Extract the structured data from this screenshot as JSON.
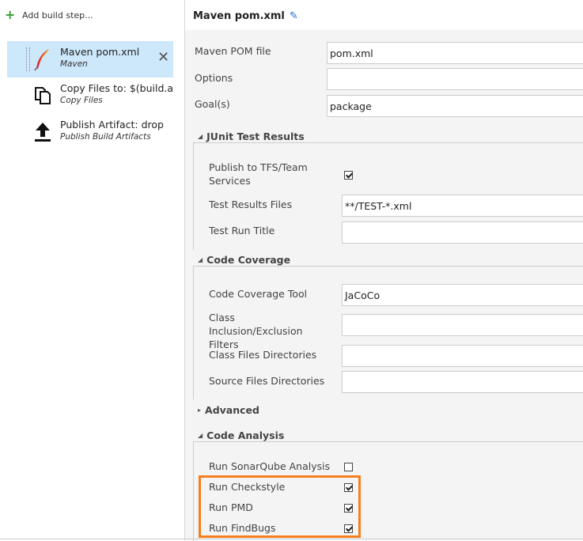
{
  "sidebar": {
    "add_step": "Add build step...",
    "steps": [
      {
        "title": "Maven pom.xml",
        "subtitle": "Maven",
        "icon": "maven-feather-icon",
        "selected": true
      },
      {
        "title": "Copy Files to: $(build.a",
        "subtitle": "Copy Files",
        "icon": "copy-files-icon"
      },
      {
        "title": "Publish Artifact: drop",
        "subtitle": "Publish Build Artifacts",
        "icon": "upload-arrow-icon"
      }
    ]
  },
  "editor": {
    "title": "Maven pom.xml",
    "fields": {
      "pom_label": "Maven POM file",
      "pom_value": "pom.xml",
      "options_label": "Options",
      "options_value": "",
      "goals_label": "Goal(s)",
      "goals_value": "package"
    },
    "junit": {
      "title": "JUnit Test Results",
      "publish_label": "Publish to TFS/Team Services",
      "publish_checked": true,
      "files_label": "Test Results Files",
      "files_value": "**/TEST-*.xml",
      "run_title_label": "Test Run Title",
      "run_title_value": ""
    },
    "coverage": {
      "title": "Code Coverage",
      "tool_label": "Code Coverage Tool",
      "tool_value": "JaCoCo",
      "filters_label": "Class Inclusion/Exclusion Filters",
      "class_dirs_label": "Class Files Directories",
      "source_dirs_label": "Source Files Directories"
    },
    "advanced": {
      "title": "Advanced"
    },
    "analysis": {
      "title": "Code Analysis",
      "sonar_label": "Run SonarQube Analysis",
      "sonar_checked": false,
      "checkstyle_label": "Run Checkstyle",
      "checkstyle_checked": true,
      "pmd_label": "Run PMD",
      "pmd_checked": true,
      "findbugs_label": "Run FindBugs",
      "findbugs_checked": true
    }
  },
  "colors": {
    "highlight": "#f57f20",
    "selected_bg": "#cde7fb",
    "accent": "#1e6fc8",
    "add_green": "#3a9c37"
  }
}
